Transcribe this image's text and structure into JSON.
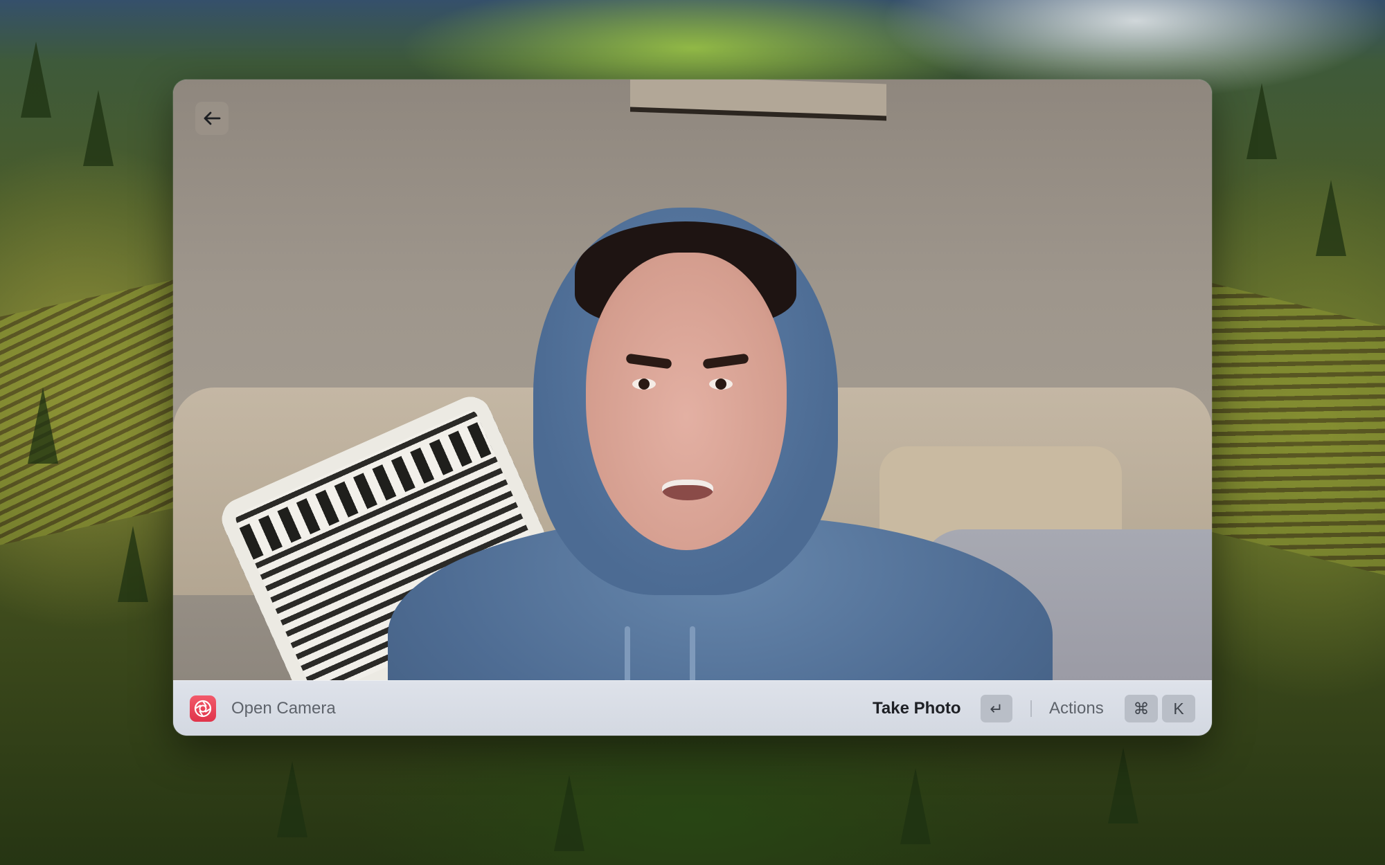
{
  "window": {
    "back_button_icon": "arrow-left-icon"
  },
  "action_bar": {
    "app_icon": "camera-aperture-icon",
    "app_title": "Open Camera",
    "primary_action_label": "Take Photo",
    "primary_action_key": "↵",
    "actions_label": "Actions",
    "actions_keys": [
      "⌘",
      "K"
    ]
  },
  "colors": {
    "app_icon_accent": "#e8404f",
    "bar_background": "#d8dce4",
    "primary_text": "#1e2025",
    "secondary_text": "#5e636b"
  }
}
